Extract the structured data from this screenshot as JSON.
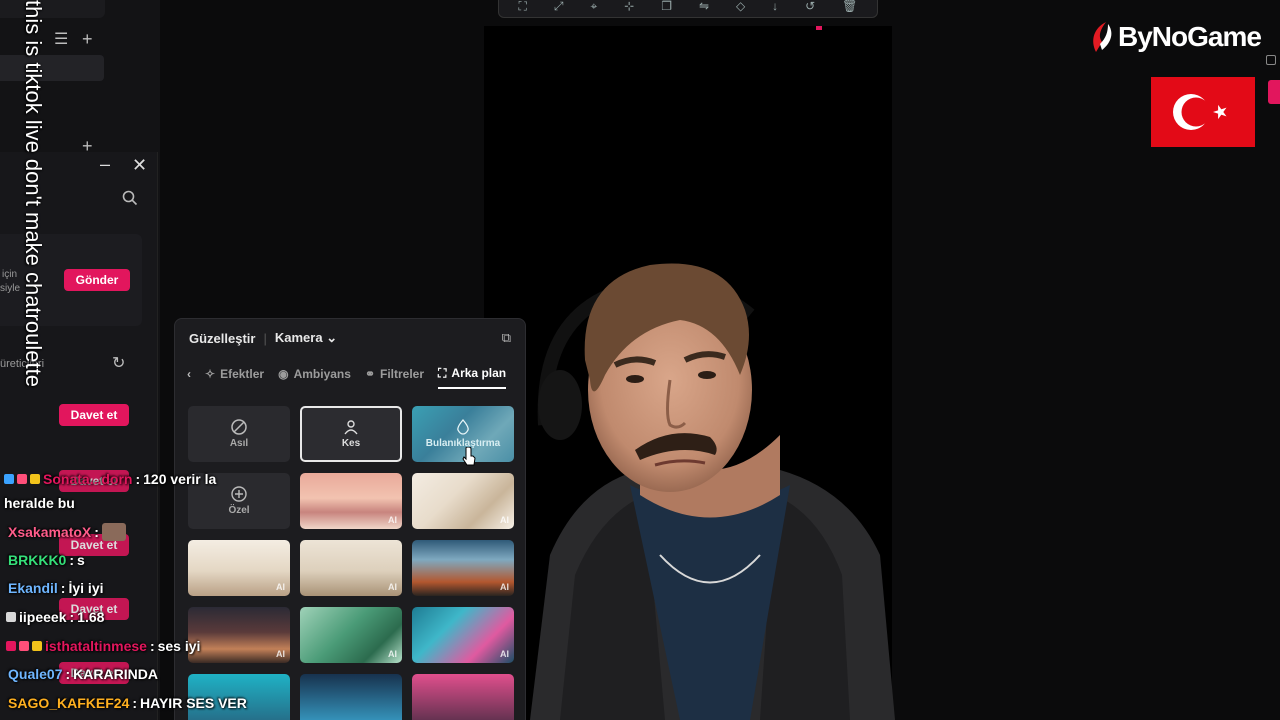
{
  "overlay_caption": "this is tiktok live don't make chatroulette",
  "brand": {
    "name": "ByNoGame"
  },
  "left_panel": {
    "send_button": "Gönder",
    "invite_button": "Davet et",
    "partial_text_1": "için",
    "partial_text_2": "siyle",
    "partial_heading": "üreticileri"
  },
  "beautify_panel": {
    "title": "Güzelleştir",
    "source": "Kamera",
    "tabs": [
      {
        "label": "Efektler",
        "icon": "effects-icon"
      },
      {
        "label": "Ambiyans",
        "icon": "ambiance-icon"
      },
      {
        "label": "Filtreler",
        "icon": "filters-icon"
      },
      {
        "label": "Arka plan",
        "icon": "background-icon",
        "active": true
      }
    ],
    "options": [
      {
        "label": "Asıl",
        "icon": "none-icon"
      },
      {
        "label": "Kes",
        "icon": "person-icon",
        "selected": true
      },
      {
        "label": "Bulanıklaştırma",
        "icon": "drop-icon"
      },
      {
        "label": "Özel",
        "icon": "add-icon"
      }
    ],
    "ai_badge": "AI"
  },
  "chat": [
    {
      "user": "Sonata...dorn",
      "user_color": "#e2165d",
      "message": "120 verir la"
    },
    {
      "user": "",
      "user_color": "#ffffff",
      "message": "heralde bu"
    },
    {
      "user": "XsakamatoX",
      "user_color": "#ff5c8a",
      "message": ""
    },
    {
      "user": "BRKKK0",
      "user_color": "#35e07a",
      "message": "s"
    },
    {
      "user": "Ekandil",
      "user_color": "#6fb6ff",
      "message": "İyi iyi"
    },
    {
      "user": "iipeeek",
      "user_color": "#ffffff",
      "message": "1.68"
    },
    {
      "user": "isthataltinmese",
      "user_color": "#e2165d",
      "message": "ses iyi"
    },
    {
      "user": "Quale07",
      "user_color": "#6fb6ff",
      "message": "KARARINDA"
    },
    {
      "user": "SAGO_KAFKEF24",
      "user_color": "#ffb020",
      "message": "HAYIR SES VER"
    }
  ]
}
